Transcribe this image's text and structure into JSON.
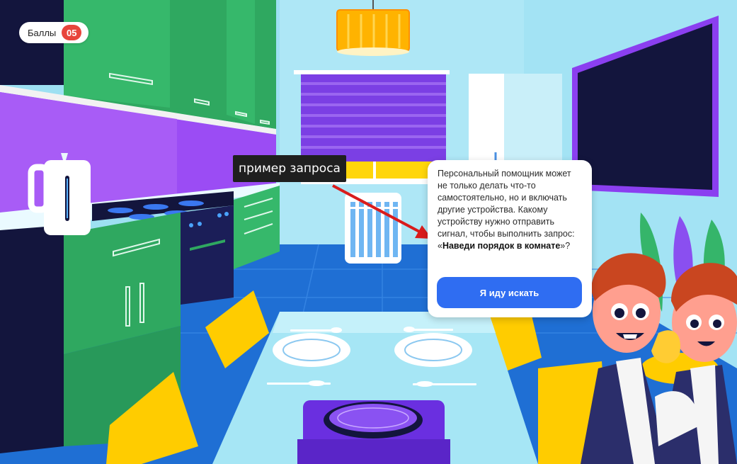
{
  "hud": {
    "score_label": "Баллы",
    "score_value": "05"
  },
  "annotation": {
    "label": "пример запроса"
  },
  "dialog": {
    "text_before": "Персональный помощник может не только делать что-то самостоятельно, но и включать другие устройства. Какому устройству нужно отправить сигнал, чтобы выполнить запрос: «",
    "text_bold": "Наведи порядок в комнате",
    "text_after": "»?",
    "button_label": "Я иду искать"
  },
  "colors": {
    "accent": "#2f6df2",
    "badge": "#e8453c",
    "cabinet": "#2fa860",
    "wall": "#a8e6f5",
    "arrow": "#d91c1c"
  },
  "icons": [
    "lamp-icon",
    "window-blind-icon",
    "refrigerator-icon",
    "tv-icon",
    "kettle-icon",
    "stove-icon",
    "air-purifier-icon",
    "plate-icon",
    "spoon-icon",
    "chair-icon",
    "character-icon",
    "arrow-icon"
  ]
}
